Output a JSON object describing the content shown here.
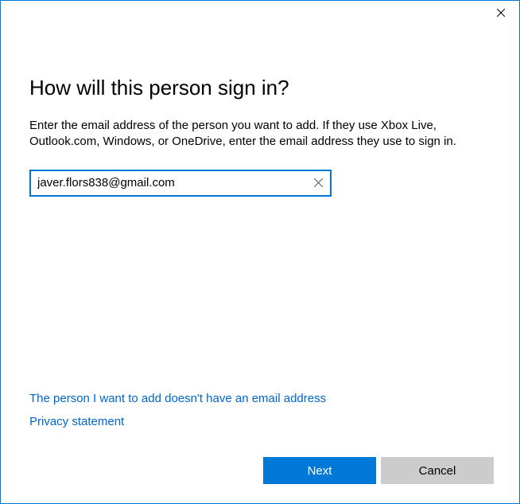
{
  "heading": "How will this person sign in?",
  "description": "Enter the email address of the person you want to add. If they use Xbox Live, Outlook.com, Windows, or OneDrive, enter the email address they use to sign in.",
  "email_input": {
    "value": "javer.flors838@gmail.com",
    "placeholder": ""
  },
  "links": {
    "no_email": "The person I want to add doesn't have an email address",
    "privacy": "Privacy statement"
  },
  "buttons": {
    "next": "Next",
    "cancel": "Cancel"
  }
}
